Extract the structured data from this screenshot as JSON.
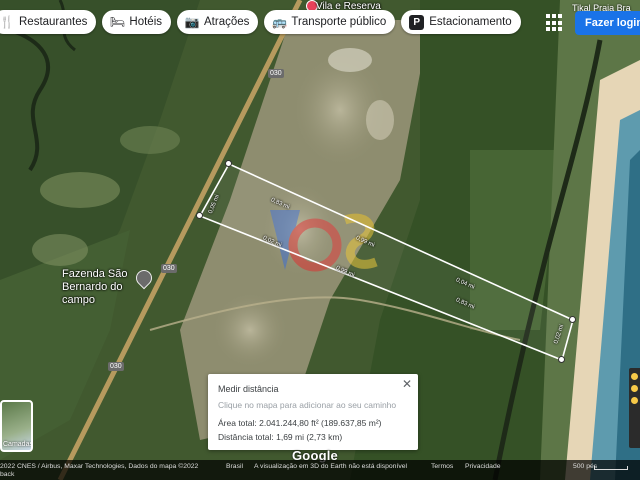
{
  "top_chips": [
    {
      "label": "Restaurantes",
      "icon": "fork-knife-icon"
    },
    {
      "label": "Hotéis",
      "icon": "bed-icon"
    },
    {
      "label": "Atrações",
      "icon": "camera-icon"
    },
    {
      "label": "Transporte público",
      "icon": "bus-icon"
    },
    {
      "label": "Estacionamento",
      "icon": "parking-icon"
    }
  ],
  "header": {
    "login_label": "Fazer login",
    "place_top": "Tikal Praia Bra"
  },
  "map_labels": {
    "fazenda": "Fazenda São Bernardo do campo",
    "vila_reserva": "Vila e Reserva",
    "road_refs": [
      "030",
      "030",
      "030"
    ]
  },
  "measure_segments": [
    "0,99 mi",
    "0,83 mi",
    "0,05 mi",
    "0,02 mi",
    "0,83 mi",
    "0,02 mi",
    "0,99 mi",
    "0,04 mi"
  ],
  "distance_panel": {
    "title": "Medir distância",
    "hint": "Clique no mapa para adicionar ao seu caminho",
    "area": "Área total: 2.041.244,80 ft² (189.637,85 m²)",
    "distance": "Distância total: 1,69 mi (2,73 km)"
  },
  "layers_button": {
    "label": "Camadas"
  },
  "google_logo": "Google",
  "footer": {
    "imagery": "2022 CNES / Airbus, Maxar Technologies, Dados do mapa ©2022",
    "country": "Brasil",
    "earth": "A visualização em 3D do Earth não está disponível",
    "terms": "Termos",
    "privacy": "Privacidade",
    "scale": "500 pés",
    "feedback": "back"
  },
  "colors": {
    "accent": "#1a73e8",
    "measure_line": "#ffffff"
  }
}
